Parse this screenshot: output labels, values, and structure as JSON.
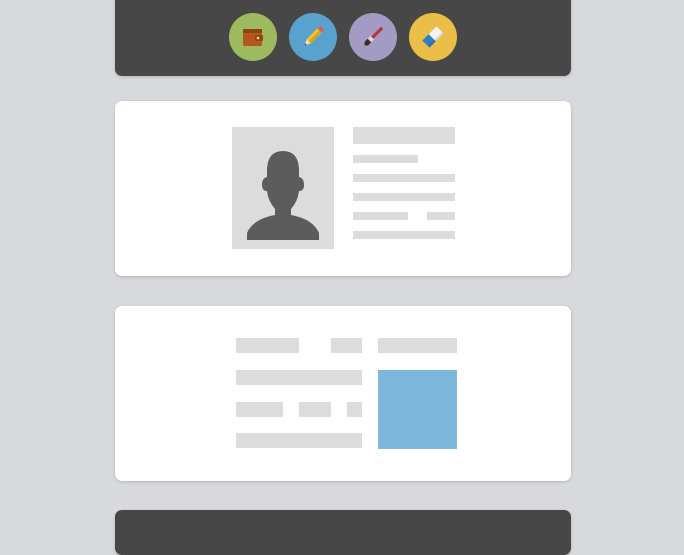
{
  "toolbar": {
    "tools": [
      {
        "name": "wallet",
        "icon": "wallet-icon",
        "bg": "#9dba5e"
      },
      {
        "name": "pencil",
        "icon": "pencil-icon",
        "bg": "#5aa2ce"
      },
      {
        "name": "brush",
        "icon": "paintbrush-icon",
        "bg": "#a39bc4"
      },
      {
        "name": "eraser",
        "icon": "eraser-icon",
        "bg": "#eabe47"
      }
    ]
  },
  "colors": {
    "dark_panel": "#474747",
    "placeholder": "#dcdcdc",
    "avatar": "#5c5c5c",
    "image_block": "#7db8dc",
    "background": "#d8d9dd"
  }
}
